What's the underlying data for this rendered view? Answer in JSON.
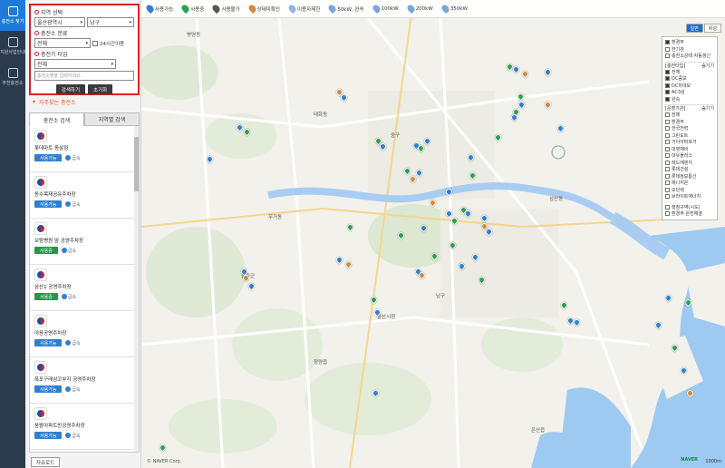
{
  "nav": [
    {
      "label": "충전소 찾기",
      "active": true
    },
    {
      "label": "지원사업안내",
      "active": false
    },
    {
      "label": "추천충전소",
      "active": false
    }
  ],
  "search": {
    "region_label": "지역 선택",
    "region_value": "울산광역시",
    "district_value": "남구",
    "type_label": "충전소 분류",
    "type_value": "전체",
    "open24_label": "24시간이용",
    "charger_label": "충전기 타입",
    "charger_value": "전체",
    "keyword_placeholder": "충전소명을 입력하세요.",
    "search_btn": "검색하기",
    "reset_btn": "초기화"
  },
  "collapse_label": "자주찾는 충전소",
  "tabs": [
    "충전소 검색",
    "지역별 검색"
  ],
  "stations": [
    {
      "name": "롯데마트 동삼점",
      "status": "사용가능",
      "status_color": "blue",
      "type": "급속"
    },
    {
      "name": "동수목재공유주차장",
      "status": "사용가능",
      "status_color": "blue",
      "type": "급속"
    },
    {
      "name": "보람병원 앞 공영주차장",
      "status": "사용중",
      "status_color": "green",
      "type": "급속"
    },
    {
      "name": "삼산1 공영주차장",
      "status": "사용중",
      "status_color": "green",
      "type": "급속"
    },
    {
      "name": "야음공영주차장",
      "status": "사용가능",
      "status_color": "blue",
      "type": "급속"
    },
    {
      "name": "폭포구래삼꼬부지 공영주차장",
      "status": "사용가능",
      "status_color": "blue",
      "type": "급속"
    },
    {
      "name": "웅왕아파트빈공영주차장",
      "status": "사용가능",
      "status_color": "blue",
      "type": "급속"
    }
  ],
  "bottom_btn": "자유로드",
  "legend": [
    {
      "label": "사용가능",
      "color": "#2f7fd1"
    },
    {
      "label": "사용중",
      "color": "#2aa24d"
    },
    {
      "label": "사용불가",
      "color": "#555555"
    },
    {
      "label": "상태미확인",
      "color": "#d68a3a"
    },
    {
      "label": "이용자제한",
      "color": "#8fb3e6"
    },
    {
      "label": "50kW, 완속",
      "color": "#7aa6d9"
    },
    {
      "label": "100kW",
      "color": "#7aa6d9"
    },
    {
      "label": "200kW",
      "color": "#7aa6d9"
    },
    {
      "label": "350kW",
      "color": "#7aa6d9"
    }
  ],
  "map_controls": [
    "일반",
    "위성"
  ],
  "filter": {
    "top": [
      {
        "label": "환경부",
        "on": true
      },
      {
        "label": "한기관",
        "on": false
      },
      {
        "label": "충전소상태 자동갱신",
        "on": false
      }
    ],
    "type_header": "[충전타입]",
    "type_toggle": "숨기기",
    "types": [
      {
        "label": "전체",
        "on": true
      },
      {
        "label": "DC콤보",
        "on": true
      },
      {
        "label": "DC차데모",
        "on": true
      },
      {
        "label": "AC3상",
        "on": true
      },
      {
        "label": "완속",
        "on": true
      }
    ],
    "op_header": "[운영기관]",
    "op_toggle": "숨기기",
    "ops": [
      {
        "label": "전체",
        "on": false
      },
      {
        "label": "환경부",
        "on": false
      },
      {
        "label": "한국전력",
        "on": false
      },
      {
        "label": "그린도트",
        "on": false
      },
      {
        "label": "가이아퍼포거",
        "on": false
      },
      {
        "label": "대영채비",
        "on": false
      },
      {
        "label": "대유플러스",
        "on": false
      },
      {
        "label": "레드에덴지",
        "on": false
      },
      {
        "label": "롯데건설",
        "on": false
      },
      {
        "label": "롯데정보통신",
        "on": false
      },
      {
        "label": "매니지온",
        "on": false
      },
      {
        "label": "모던텍",
        "on": false
      },
      {
        "label": "브라이트에너지",
        "on": false
      }
    ],
    "extra": [
      {
        "label": "행정구역(시도)",
        "on": false
      },
      {
        "label": "환경부 완전해결",
        "on": false
      }
    ]
  },
  "places": [
    "병영동",
    "중구",
    "남구",
    "삼산동",
    "울주군",
    "태화동",
    "울산시청",
    "무거동",
    "청량읍",
    "온산읍"
  ],
  "copyright": "© NAVER Corp.",
  "naver": "NAVER",
  "scale": "1000m"
}
